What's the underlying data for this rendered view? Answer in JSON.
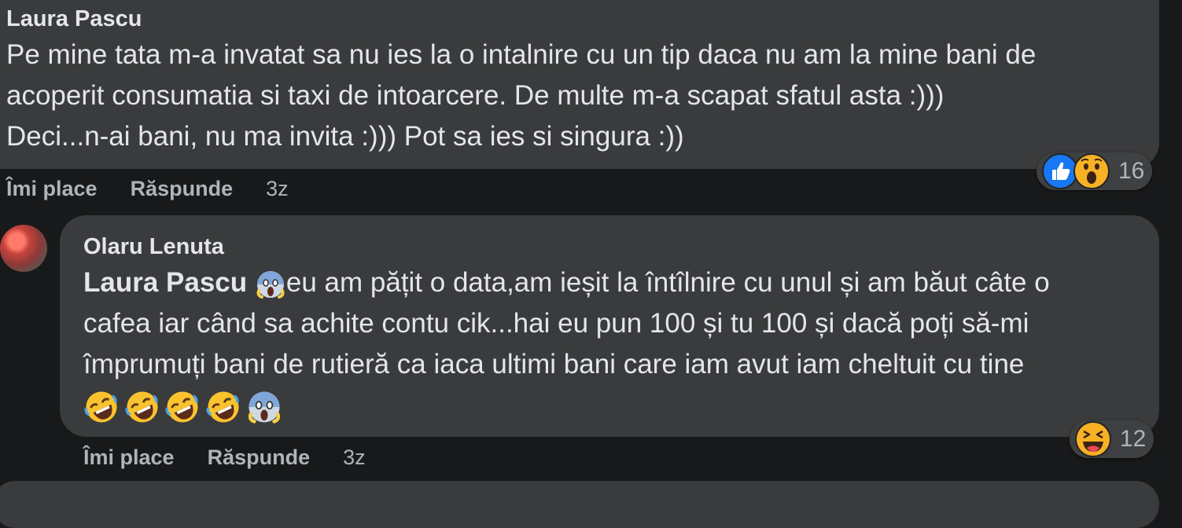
{
  "comments": [
    {
      "author": "Laura Pascu",
      "lines": [
        "Pe mine tata m-a invatat sa nu ies la o intalnire cu un tip daca nu am la mine bani de",
        "acoperit consumatia si taxi de intoarcere. De multe m-a scapat sfatul asta :)))",
        "Deci...n-ai bani, nu ma invita :))) Pot sa ies si singura :))"
      ],
      "actions": {
        "like": "Îmi place",
        "reply": "Răspunde",
        "time": "3z"
      },
      "reactions": {
        "icons": [
          "like-icon",
          "wow-icon"
        ],
        "count": "16"
      }
    },
    {
      "author": "Olaru Lenuta",
      "mention": "Laura Pascu",
      "line1_after": "eu am pățit o data,am ieșit la întîlnire cu unul și am băut câte o",
      "line2": "cafea iar când sa achite contu cik...hai eu pun 100 și tu 100 și dacă poți să-mi",
      "line3": "împrumuți bani de rutieră ca iaca ultimi bani care iam avut iam cheltuit cu tine",
      "emoji_row": [
        "rofl-emoji",
        "rofl-emoji",
        "rofl-emoji",
        "rofl-emoji",
        "scream-emoji"
      ],
      "actions": {
        "like": "Îmi place",
        "reply": "Răspunde",
        "time": "3z"
      },
      "reactions": {
        "icons": [
          "haha-icon"
        ],
        "count": "12"
      }
    }
  ],
  "colors": {
    "background": "#18191a",
    "bubble": "#3a3b3c",
    "text": "#e4e6eb",
    "muted": "#b0b3b8",
    "like_blue": "#1877f2"
  }
}
